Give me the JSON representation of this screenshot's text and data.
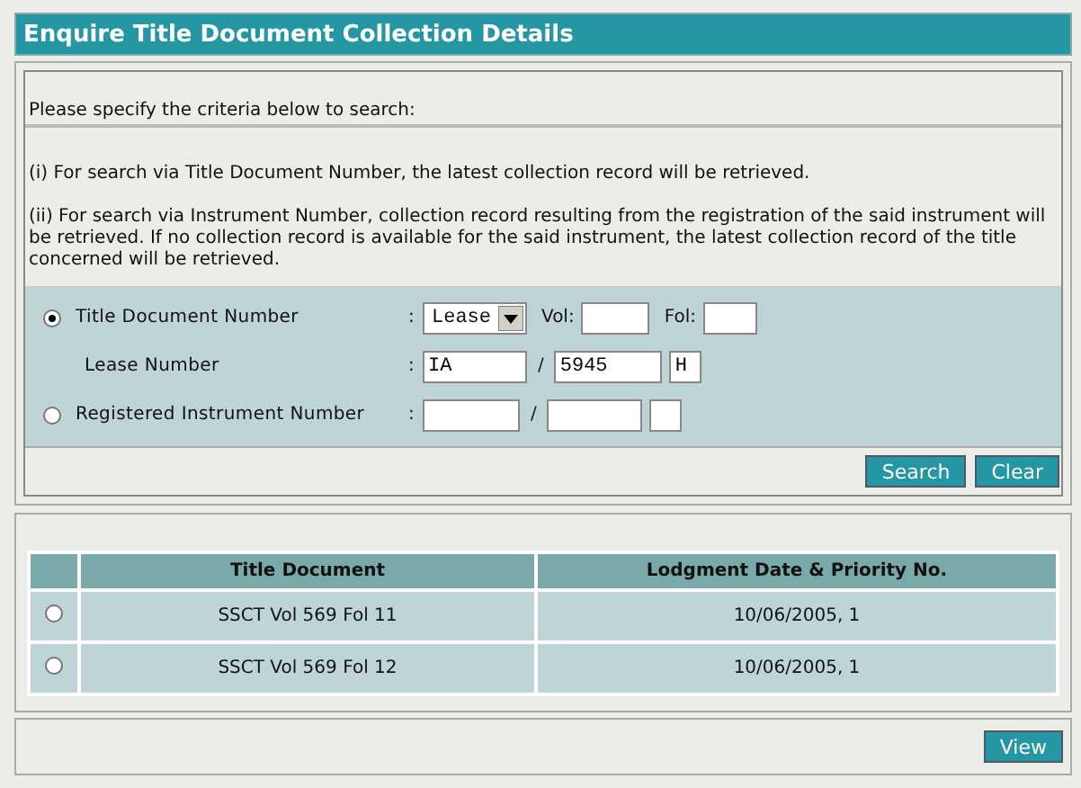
{
  "header": {
    "title": "Enquire Title Document Collection Details"
  },
  "instructions": {
    "prompt": "Please specify the criteria below to search:",
    "notes": [
      "(i) For search via Title Document Number, the latest collection record will be retrieved.",
      "(ii) For search via Instrument Number, collection record resulting from the registration of the said instrument will be retrieved. If no collection record is available for the said instrument, the latest collection record of the title concerned will be retrieved."
    ]
  },
  "criteria": [
    {
      "kind": "title",
      "label": "Title Document Number",
      "selected": true,
      "colon": ":",
      "type_select": "Lease",
      "vol_label": "Vol:",
      "fol_label": "Fol:"
    },
    {
      "kind": "lease",
      "label": "Lease Number",
      "colon": ":",
      "part_1": "IA",
      "slash": "/",
      "part_2": "5945",
      "part_3": "H"
    },
    {
      "kind": "instrument",
      "label": "Registered Instrument Number",
      "selected": false,
      "colon": ":",
      "slash": "/"
    }
  ],
  "buttons": [
    {
      "label": "Search"
    },
    {
      "label": "Clear"
    }
  ],
  "results": {
    "columns": [
      "Title Document",
      "Lodgment Date & Priority No."
    ],
    "rows": [
      {
        "selected": false,
        "title_document": "SSCT Vol 569 Fol 11",
        "lodgment": "10/06/2005, 1"
      },
      {
        "selected": false,
        "title_document": "SSCT Vol 569 Fol 12",
        "lodgment": "10/06/2005, 1"
      }
    ]
  },
  "footer": {
    "button": "View"
  }
}
